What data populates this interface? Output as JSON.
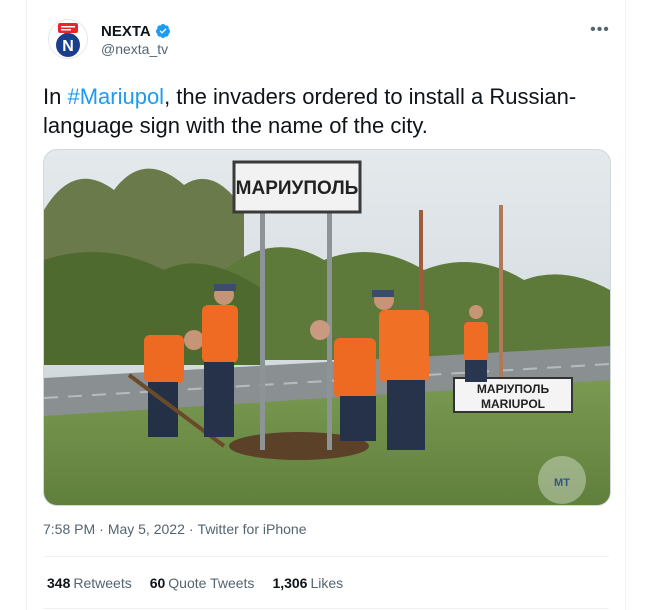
{
  "author": {
    "name": "NEXTA",
    "handle": "@nexta_tv",
    "verified": true,
    "avatar_letter": "N"
  },
  "menu_icon": "more-horizontal-icon",
  "tweet": {
    "prefix": "In ",
    "hashtag": "#Mariupol",
    "suffix": ", the invaders ordered to install a Russian-language sign with the name of the city."
  },
  "image": {
    "sign_top": "МАРИУПОЛЬ",
    "sign_low_line1": "МАРІУПОЛЬ",
    "sign_low_line2": "MARIUPOL",
    "watermark": "MT"
  },
  "meta": {
    "time": "7:58 PM",
    "sep1": "·",
    "date": "May 5, 2022",
    "sep2": "·",
    "source": "Twitter for iPhone"
  },
  "stats": {
    "retweets_count": "348",
    "retweets_label": "Retweets",
    "quotes_count": "60",
    "quotes_label": "Quote Tweets",
    "likes_count": "1,306",
    "likes_label": "Likes"
  },
  "colors": {
    "accent": "#1d9bf0",
    "text": "#0f1419",
    "secondary": "#536471",
    "nexta_red": "#e8262e",
    "nexta_blue": "#1b3e8c"
  }
}
